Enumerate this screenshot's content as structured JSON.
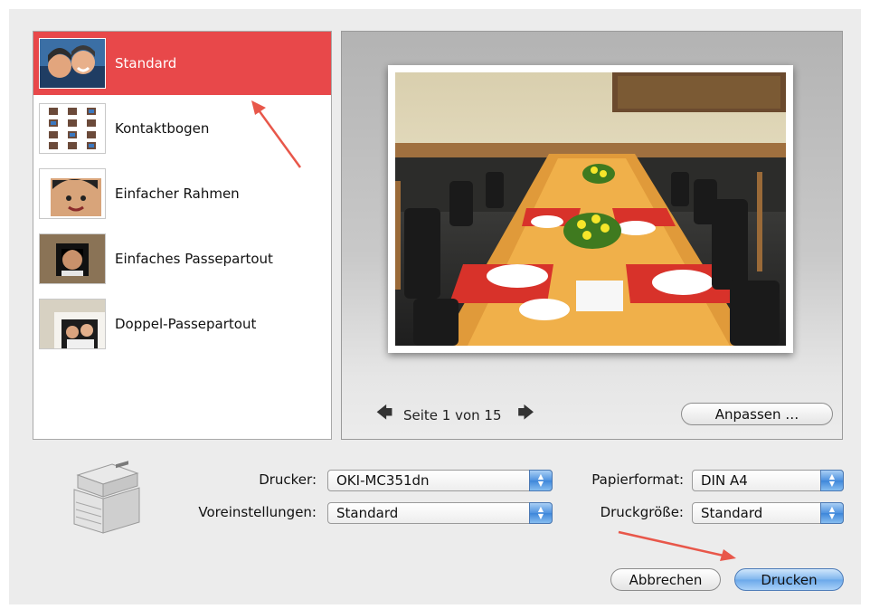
{
  "layouts": {
    "items": [
      {
        "label": "Standard",
        "selected": true,
        "thumb_icon": "portrait-photo-thumb"
      },
      {
        "label": "Kontaktbogen",
        "selected": false,
        "thumb_icon": "contact-sheet-thumb"
      },
      {
        "label": "Einfacher Rahmen",
        "selected": false,
        "thumb_icon": "simple-frame-thumb"
      },
      {
        "label": "Einfaches Passepartout",
        "selected": false,
        "thumb_icon": "simple-mat-thumb"
      },
      {
        "label": "Doppel-Passepartout",
        "selected": false,
        "thumb_icon": "double-mat-thumb"
      }
    ]
  },
  "preview": {
    "page_text": "Seite 1 von 15",
    "fit_button": "Anpassen …"
  },
  "settings": {
    "printer_label": "Drucker:",
    "printer_value": "OKI-MC351dn",
    "presets_label": "Voreinstellungen:",
    "presets_value": "Standard",
    "paper_label": "Papierformat:",
    "paper_value": "DIN A4",
    "print_size_label": "Druckgröße:",
    "print_size_value": "Standard"
  },
  "actions": {
    "cancel": "Abbrechen",
    "print": "Drucken"
  },
  "colors": {
    "selection": "#e8484a",
    "annotation_arrow": "#e8574a",
    "primary_button": "#6aa8ea"
  }
}
